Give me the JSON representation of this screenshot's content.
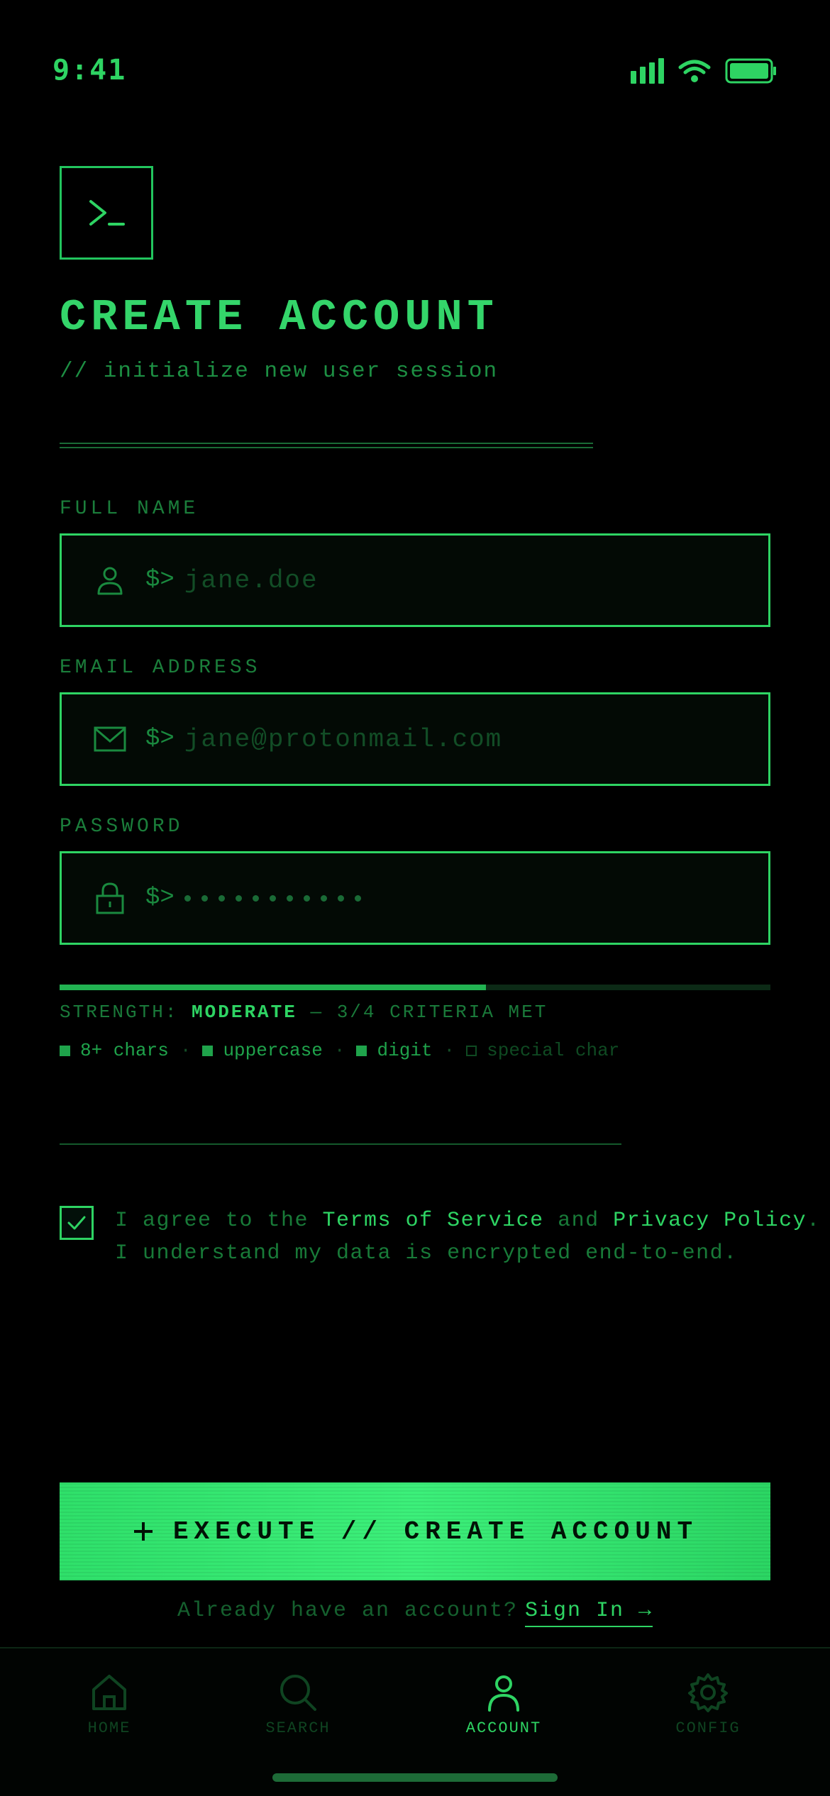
{
  "status": {
    "time": "9:41"
  },
  "header": {
    "title": "CREATE ACCOUNT",
    "subtitle": "// initialize new user session"
  },
  "form": {
    "prompt": "$>",
    "full_name": {
      "label": "FULL NAME",
      "placeholder": "jane.doe"
    },
    "email": {
      "label": "EMAIL ADDRESS",
      "placeholder": "jane@protonmail.com"
    },
    "password": {
      "label": "PASSWORD",
      "masked_length": 11
    }
  },
  "strength": {
    "prefix": "STRENGTH:",
    "level": "MODERATE",
    "summary": "— 3/4 CRITERIA MET",
    "fraction": 0.6,
    "criteria": [
      {
        "label": "8+ chars",
        "met": true
      },
      {
        "label": "uppercase",
        "met": true
      },
      {
        "label": "digit",
        "met": true
      },
      {
        "label": "special char",
        "met": false
      }
    ]
  },
  "agreement": {
    "checked": true,
    "text_1": "I agree to the ",
    "tos": "Terms of Service",
    "text_2": " and ",
    "privacy": "Privacy Policy",
    "text_3": ".",
    "line_2": "I understand my data is encrypted end-to-end."
  },
  "primary_button": {
    "icon": "plus-icon",
    "label": "EXECUTE // CREATE ACCOUNT"
  },
  "signin": {
    "text": "Already have an account?",
    "link": "Sign In →"
  },
  "tabbar": {
    "active": "account",
    "items": [
      {
        "id": "home",
        "label": "HOME",
        "icon": "home-icon"
      },
      {
        "id": "search",
        "label": "SEARCH",
        "icon": "search-icon"
      },
      {
        "id": "account",
        "label": "ACCOUNT",
        "icon": "user-icon"
      },
      {
        "id": "config",
        "label": "CONFIG",
        "icon": "gear-icon"
      }
    ]
  },
  "colors": {
    "accent": "#2ed463",
    "background": "#000000",
    "dim": "#1a7a3a"
  }
}
